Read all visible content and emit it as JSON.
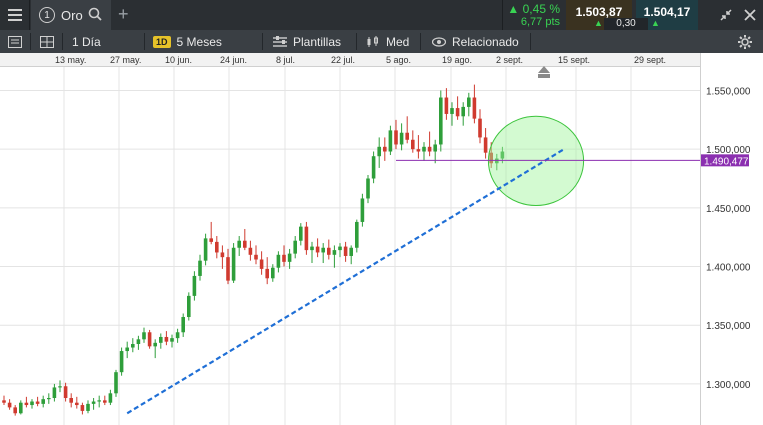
{
  "topbar": {
    "tab_number": "1",
    "tab_name": "Oro",
    "add_label": "+",
    "change_pct": "▲ 0,45 %",
    "change_pts": "6,77 pts",
    "sell_price": "1.503,87",
    "buy_price": "1.504,17",
    "spread": "0,30"
  },
  "toolbar": {
    "interval": "1 Día",
    "range_badge": "1D",
    "range": "5 Meses",
    "templates": "Plantillas",
    "chart_type": "Med",
    "related": "Relacionado"
  },
  "xaxis": {
    "labels": [
      "13 may.",
      "27 may.",
      "10 jun.",
      "24 jun.",
      "8 jul.",
      "22 jul.",
      "5 ago.",
      "19 ago.",
      "2 sept.",
      "15 sept.",
      "29 sept."
    ]
  },
  "price_axis": {
    "labels": [
      "1.550,000",
      "1.500,000",
      "1.450,000",
      "1.400,000",
      "1.350,000",
      "1.300,000"
    ],
    "current_price": "1.490,477"
  },
  "colors": {
    "up": "#2e9e3a",
    "down": "#d03a2f",
    "trendline": "#1f6fd6",
    "current_line": "#8b2fb0",
    "ellipse_fill": "#9ef59a",
    "ellipse_stroke": "#3cc43c"
  },
  "chart_data": {
    "type": "candlestick",
    "title": "",
    "ylim": [
      1265,
      1570
    ],
    "y_ticks": [
      1300,
      1350,
      1400,
      1450,
      1500,
      1550
    ],
    "x_ticks": [
      "13 may.",
      "27 may.",
      "10 jun.",
      "24 jun.",
      "8 jul.",
      "22 jul.",
      "5 ago.",
      "19 ago.",
      "2 sept.",
      "15 sept.",
      "29 sept."
    ],
    "candles": [
      [
        1286,
        1290,
        1282,
        1284
      ],
      [
        1284,
        1287,
        1278,
        1280
      ],
      [
        1280,
        1282,
        1273,
        1275
      ],
      [
        1275,
        1286,
        1274,
        1284
      ],
      [
        1284,
        1289,
        1280,
        1282
      ],
      [
        1282,
        1287,
        1279,
        1285
      ],
      [
        1285,
        1289,
        1281,
        1283
      ],
      [
        1283,
        1290,
        1280,
        1287
      ],
      [
        1287,
        1292,
        1283,
        1288
      ],
      [
        1288,
        1300,
        1285,
        1297
      ],
      [
        1297,
        1303,
        1293,
        1298
      ],
      [
        1298,
        1301,
        1285,
        1288
      ],
      [
        1288,
        1292,
        1280,
        1284
      ],
      [
        1284,
        1289,
        1279,
        1282
      ],
      [
        1282,
        1284,
        1274,
        1277
      ],
      [
        1277,
        1286,
        1275,
        1283
      ],
      [
        1283,
        1288,
        1278,
        1285
      ],
      [
        1285,
        1290,
        1280,
        1286
      ],
      [
        1286,
        1290,
        1282,
        1284
      ],
      [
        1284,
        1295,
        1282,
        1292
      ],
      [
        1292,
        1312,
        1289,
        1310
      ],
      [
        1310,
        1331,
        1307,
        1328
      ],
      [
        1328,
        1336,
        1322,
        1331
      ],
      [
        1331,
        1339,
        1327,
        1334
      ],
      [
        1334,
        1341,
        1329,
        1338
      ],
      [
        1338,
        1348,
        1335,
        1344
      ],
      [
        1344,
        1346,
        1330,
        1332
      ],
      [
        1332,
        1338,
        1322,
        1335
      ],
      [
        1335,
        1343,
        1330,
        1340
      ],
      [
        1340,
        1345,
        1333,
        1336
      ],
      [
        1336,
        1342,
        1331,
        1339
      ],
      [
        1339,
        1347,
        1335,
        1344
      ],
      [
        1344,
        1360,
        1340,
        1357
      ],
      [
        1357,
        1378,
        1354,
        1375
      ],
      [
        1375,
        1396,
        1371,
        1392
      ],
      [
        1392,
        1410,
        1388,
        1405
      ],
      [
        1405,
        1428,
        1401,
        1424
      ],
      [
        1424,
        1438,
        1419,
        1421
      ],
      [
        1421,
        1426,
        1407,
        1412
      ],
      [
        1412,
        1418,
        1398,
        1408
      ],
      [
        1408,
        1415,
        1385,
        1388
      ],
      [
        1388,
        1420,
        1386,
        1416
      ],
      [
        1416,
        1426,
        1409,
        1422
      ],
      [
        1422,
        1432,
        1414,
        1416
      ],
      [
        1416,
        1422,
        1405,
        1410
      ],
      [
        1410,
        1418,
        1402,
        1406
      ],
      [
        1406,
        1413,
        1393,
        1398
      ],
      [
        1398,
        1408,
        1385,
        1390
      ],
      [
        1390,
        1402,
        1387,
        1399
      ],
      [
        1399,
        1413,
        1395,
        1410
      ],
      [
        1410,
        1418,
        1400,
        1404
      ],
      [
        1404,
        1415,
        1398,
        1411
      ],
      [
        1411,
        1426,
        1407,
        1422
      ],
      [
        1422,
        1437,
        1418,
        1434
      ],
      [
        1434,
        1438,
        1410,
        1414
      ],
      [
        1414,
        1421,
        1403,
        1417
      ],
      [
        1417,
        1424,
        1408,
        1412
      ],
      [
        1412,
        1420,
        1403,
        1416
      ],
      [
        1416,
        1423,
        1406,
        1410
      ],
      [
        1410,
        1418,
        1399,
        1414
      ],
      [
        1414,
        1420,
        1408,
        1417
      ],
      [
        1417,
        1421,
        1404,
        1409
      ],
      [
        1409,
        1418,
        1402,
        1416
      ],
      [
        1416,
        1440,
        1412,
        1438
      ],
      [
        1438,
        1462,
        1434,
        1458
      ],
      [
        1458,
        1478,
        1454,
        1475
      ],
      [
        1475,
        1498,
        1471,
        1494
      ],
      [
        1494,
        1510,
        1484,
        1502
      ],
      [
        1502,
        1510,
        1490,
        1498
      ],
      [
        1498,
        1520,
        1495,
        1516
      ],
      [
        1516,
        1525,
        1500,
        1504
      ],
      [
        1504,
        1522,
        1499,
        1514
      ],
      [
        1514,
        1528,
        1505,
        1508
      ],
      [
        1508,
        1516,
        1497,
        1500
      ],
      [
        1500,
        1512,
        1492,
        1498
      ],
      [
        1498,
        1506,
        1490,
        1502
      ],
      [
        1502,
        1515,
        1494,
        1498
      ],
      [
        1498,
        1508,
        1488,
        1504
      ],
      [
        1504,
        1550,
        1498,
        1544
      ],
      [
        1544,
        1552,
        1525,
        1530
      ],
      [
        1530,
        1540,
        1520,
        1535
      ],
      [
        1535,
        1545,
        1525,
        1528
      ],
      [
        1528,
        1540,
        1520,
        1536
      ],
      [
        1536,
        1548,
        1528,
        1544
      ],
      [
        1544,
        1555,
        1522,
        1526
      ],
      [
        1526,
        1534,
        1505,
        1510
      ],
      [
        1510,
        1518,
        1492,
        1497
      ],
      [
        1497,
        1506,
        1484,
        1488
      ],
      [
        1488,
        1496,
        1482,
        1492
      ],
      [
        1492,
        1502,
        1488,
        1498
      ]
    ],
    "annotations": {
      "trendline": {
        "from": [
          22,
          1275
        ],
        "to": [
          100,
          1500
        ]
      },
      "horizontal_line": {
        "from": 70,
        "price": 1490.477
      },
      "circle": {
        "center": [
          95,
          1490
        ],
        "rx": 8.5,
        "ry": 38
      }
    }
  }
}
